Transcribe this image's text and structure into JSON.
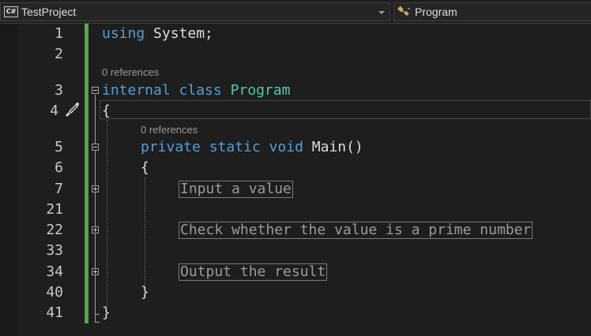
{
  "navbar": {
    "project_badge": "C#",
    "project": "TestProject",
    "class_member": "Program",
    "icons": [
      "csharp-project-icon",
      "dropdown-arrow-icon",
      "class-icon"
    ]
  },
  "editor": {
    "codelens_refs": [
      "0 references",
      "0 references"
    ],
    "line_numbers": [
      "1",
      "2",
      "3",
      "4",
      "5",
      "6",
      "7",
      "21",
      "22",
      "33",
      "34",
      "40",
      "41"
    ],
    "line1": {
      "kw": "using",
      "rest": " System;"
    },
    "line3": {
      "kw": "internal class",
      "type": "Program"
    },
    "line4": "{",
    "line5": {
      "kw": "private static void",
      "rest": " Main()"
    },
    "line6": "{",
    "regions": [
      "Input a value",
      "Check whether the value is a prime number",
      "Output the result"
    ],
    "line40": "}",
    "line41": "}",
    "colors": {
      "keyword": "#569cd6",
      "type": "#4ec9b0",
      "text": "#dcdcdc",
      "change_bar": "#57a64a",
      "background": "#1e1e1e"
    }
  }
}
